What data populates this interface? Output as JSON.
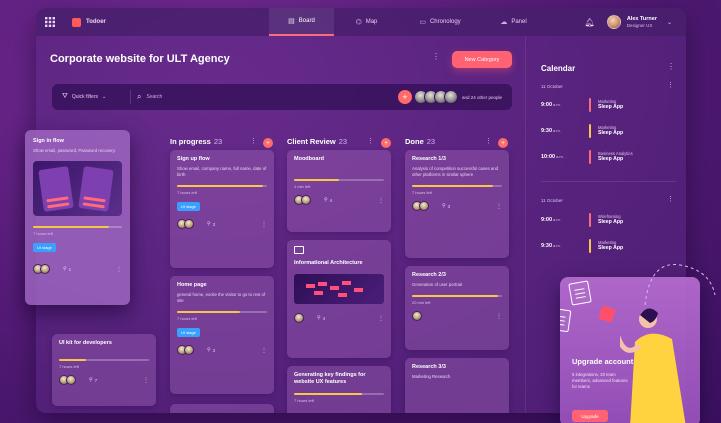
{
  "app": {
    "name": "Todoer"
  },
  "tabs": [
    {
      "label": "Board",
      "icon": "board-icon"
    },
    {
      "label": "Map",
      "icon": "map-icon"
    },
    {
      "label": "Chronology",
      "icon": "chronology-icon"
    },
    {
      "label": "Panel",
      "icon": "panel-icon"
    }
  ],
  "user": {
    "name": "Alex Turner",
    "role": "Designer UX"
  },
  "page": {
    "title": "Corporate website for ULT Agency",
    "new_category": "New Category"
  },
  "filters": {
    "quick_filters": "Quick filters",
    "search_placeholder": "Search",
    "people_text": "and 24 other people"
  },
  "columns": [
    {
      "name": "In progress",
      "count": "23"
    },
    {
      "name": "Client Review",
      "count": "23"
    },
    {
      "name": "Done",
      "count": "23"
    }
  ],
  "floating_card": {
    "title": "Sign in flow",
    "desc": "Show email, password, Password recovery.",
    "hours": "7 hours left",
    "tag": "UI stage",
    "progress": 0.85,
    "attachments": "1"
  },
  "cards": {
    "signup": {
      "title": "Sign up flow",
      "desc": "Show email, company name, full name, date of birth",
      "hours": "7 hours left",
      "tag": "UI stage",
      "progress": 0.95,
      "attachments": "3"
    },
    "home": {
      "title": "Home page",
      "desc": "general home, excite the visitor to go to rest of site",
      "hours": "7 hours left",
      "tag": "UI stage",
      "progress": 0.7,
      "attachments": "3"
    },
    "uikit": {
      "title": "UI kit for developers",
      "hours": "7 hours left",
      "progress": 0.3,
      "attachments": "7"
    },
    "moodboard": {
      "title": "Moodboard",
      "hours": "1 min left",
      "progress": 0.5,
      "attachments": "4"
    },
    "ia": {
      "title": "Informational Architecture",
      "attachments": "4"
    },
    "findings": {
      "title": "Generating key findings for website UX features",
      "hours": "7 hours left",
      "progress": 0.75
    },
    "research1": {
      "title": "Research 1/3",
      "desc": "Analysis of competition successful cases and other platforms in similar sphere",
      "hours": "7 hours left",
      "progress": 0.9,
      "attachments": "3"
    },
    "research2": {
      "title": "Research 2/3",
      "desc": "Generation of user portrait",
      "hours": "20 min left",
      "progress": 0.95
    },
    "research3": {
      "title": "Research 3/3",
      "desc": "Marketing Research"
    }
  },
  "calendar": {
    "title": "Calendar",
    "days": [
      {
        "date": "11 October",
        "events": [
          {
            "time": "9:00",
            "ampm": "a.m.",
            "category": "Marketing",
            "title": "Sleep App",
            "color": "#ff6a7a"
          },
          {
            "time": "9:30",
            "ampm": "a.m.",
            "category": "Marketing",
            "title": "Sleep App",
            "color": "#f7c74a"
          },
          {
            "time": "10:00",
            "ampm": "a.m.",
            "category": "Business Analytics",
            "title": "Sleep App",
            "color": "#ff6a7a"
          }
        ]
      },
      {
        "date": "11 October",
        "events": [
          {
            "time": "9:00",
            "ampm": "a.m.",
            "category": "Wireframing",
            "title": "Sleep App",
            "color": "#ff6a7a"
          },
          {
            "time": "9:30",
            "ampm": "a.m.",
            "category": "Marketing",
            "title": "Sleep App",
            "color": "#f7c74a"
          }
        ]
      }
    ]
  },
  "upgrade": {
    "title": "Upgrade account",
    "desc": "5 integrations, 30 team members, advanced features for teams",
    "button": "Upgrade"
  },
  "colors": {
    "accent": "#ff6272",
    "progress": "#f7c74a",
    "tag": "#3aa0ff"
  }
}
